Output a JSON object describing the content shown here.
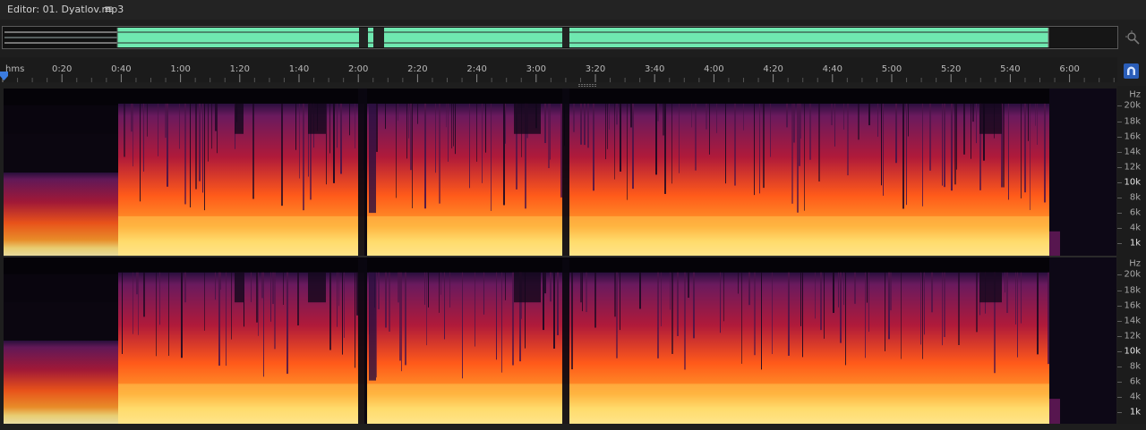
{
  "editor": {
    "title": "Editor: 01. Dyatlov.mp3",
    "menu_glyph": "≡",
    "menu_icon": "hamburger-menu-icon",
    "zoom_icon": "zoom-navigate-icon",
    "snap_icon": "magnet-snap-icon"
  },
  "ruler": {
    "unit": "hms",
    "ticks": [
      "0:20",
      "0:40",
      "1:00",
      "1:20",
      "1:40",
      "2:00",
      "2:20",
      "2:40",
      "3:00",
      "3:20",
      "3:40",
      "4:00",
      "4:20",
      "4:40",
      "5:00",
      "5:20",
      "5:40",
      "6:00"
    ]
  },
  "frequency_axis": {
    "unit": "Hz",
    "labels": [
      "20k",
      "18k",
      "16k",
      "14k",
      "12k",
      "10k",
      "8k",
      "6k",
      "4k",
      "1k"
    ]
  },
  "colors": {
    "waveform": "#6fe8b0",
    "background": "#1e1e1e",
    "accent": "#2a5db8",
    "spec_low": "#ffe27a",
    "spec_mid": "#ff5a1a",
    "spec_high": "#b01a3a",
    "spec_top": "#2a0f3e"
  }
}
